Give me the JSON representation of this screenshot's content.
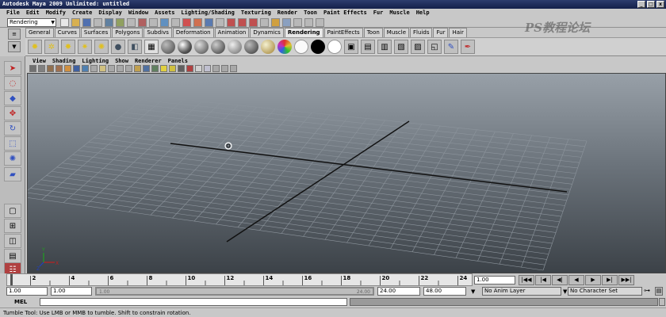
{
  "title": "Autodesk Maya 2009 Unlimited: untitled",
  "window_buttons": [
    "_",
    "□",
    "x"
  ],
  "menus": [
    "File",
    "Edit",
    "Modify",
    "Create",
    "Display",
    "Window",
    "Assets",
    "Lighting/Shading",
    "Texturing",
    "Render",
    "Toon",
    "Paint Effects",
    "Fur",
    "Muscle",
    "Help"
  ],
  "mode": "Rendering",
  "shelf_tabs": [
    "General",
    "Curves",
    "Surfaces",
    "Polygons",
    "Subdivs",
    "Deformation",
    "Animation",
    "Dynamics",
    "Rendering",
    "PaintEffects",
    "Toon",
    "Muscle",
    "Fluids",
    "Fur",
    "Hair"
  ],
  "active_shelf_tab": "Rendering",
  "panel_menus": [
    "View",
    "Shading",
    "Lighting",
    "Show",
    "Renderer",
    "Panels"
  ],
  "watermark": "PS教程论坛",
  "timeline": {
    "ticks": [
      "2",
      "4",
      "6",
      "8",
      "10",
      "12",
      "14",
      "16",
      "18",
      "20",
      "22",
      "24"
    ],
    "current_frame": "1.00",
    "range_start": "1.00",
    "playback_start": "1.00",
    "playback_end": "24.00",
    "range_end": "48.00",
    "slider_left": "1.00",
    "slider_right": "24.00"
  },
  "playback_buttons": [
    "|◀◀",
    "|◀",
    "◀|",
    "◀",
    "▶",
    "▶|",
    "▶▶|"
  ],
  "anim_layer": "No Anim Layer",
  "character_set": "No Character Set",
  "mel_label": "MEL",
  "help_text": "Tumble Tool: Use LMB or MMB to tumble. Shift to constrain rotation.",
  "colors": {
    "titlebar": "#14204a",
    "viewport_top": "#98a0a8",
    "viewport_bottom": "#3c4248",
    "grid": "#8d959d",
    "axis": "#111111"
  },
  "axis_labels": [
    "X",
    "Y",
    "Z"
  ]
}
